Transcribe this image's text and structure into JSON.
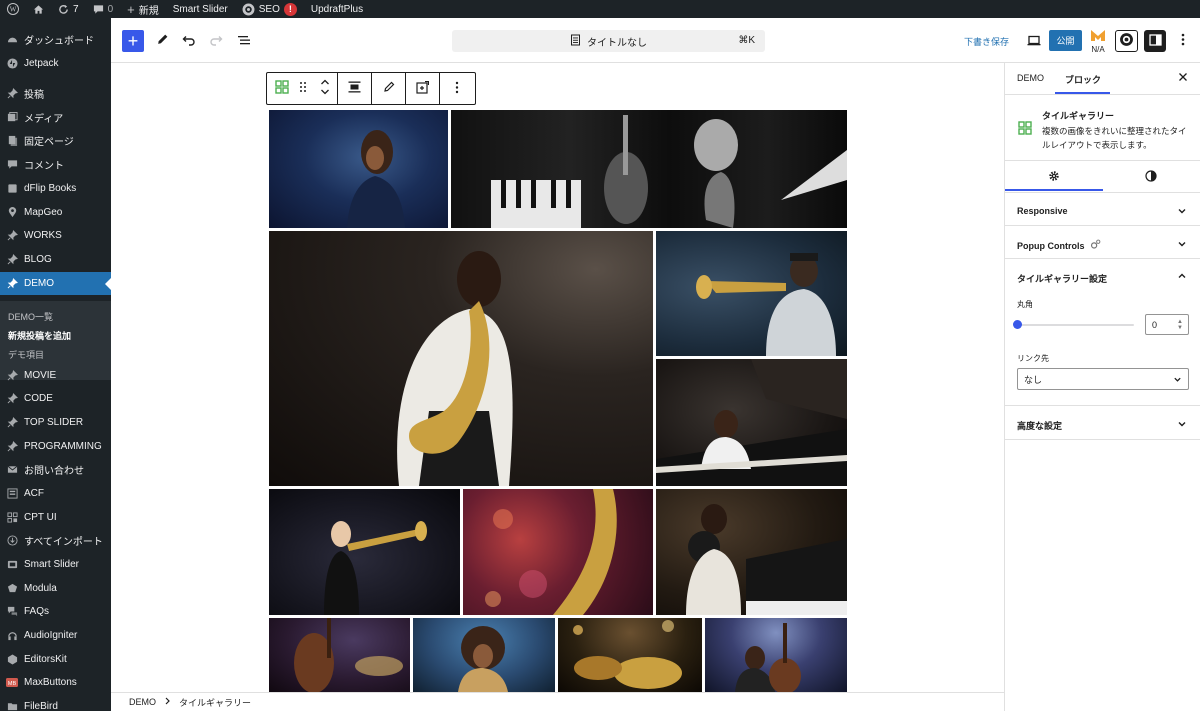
{
  "admin_bar": {
    "updates_count": "7",
    "comments_count": "0",
    "new_label": "新規",
    "smart_slider": "Smart Slider",
    "seo_label": "SEO",
    "seo_badge": "!",
    "updraft": "UpdraftPlus"
  },
  "sidebar": {
    "items": [
      {
        "label": "ダッシュボード",
        "icon": "dashboard-icon"
      },
      {
        "label": "Jetpack",
        "icon": "jetpack-icon"
      },
      {
        "label": "投稿",
        "icon": "pin-icon"
      },
      {
        "label": "メディア",
        "icon": "media-icon"
      },
      {
        "label": "固定ページ",
        "icon": "page-icon"
      },
      {
        "label": "コメント",
        "icon": "comment-icon"
      },
      {
        "label": "dFlip Books",
        "icon": "book-icon"
      },
      {
        "label": "MapGeo",
        "icon": "map-icon"
      },
      {
        "label": "WORKS",
        "icon": "pin-icon"
      },
      {
        "label": "BLOG",
        "icon": "pin-icon"
      },
      {
        "label": "DEMO",
        "icon": "pin-icon"
      },
      {
        "label": "MOVIE",
        "icon": "pin-icon"
      },
      {
        "label": "CODE",
        "icon": "pin-icon"
      },
      {
        "label": "TOP SLIDER",
        "icon": "pin-icon"
      },
      {
        "label": "PROGRAMMING",
        "icon": "pin-icon"
      },
      {
        "label": "お問い合わせ",
        "icon": "mail-icon"
      },
      {
        "label": "ACF",
        "icon": "acf-icon"
      },
      {
        "label": "CPT UI",
        "icon": "cpt-icon"
      },
      {
        "label": "すべてインポート",
        "icon": "import-icon"
      },
      {
        "label": "Smart Slider",
        "icon": "slider-icon"
      },
      {
        "label": "Modula",
        "icon": "modula-icon"
      },
      {
        "label": "FAQs",
        "icon": "faq-icon"
      },
      {
        "label": "AudioIgniter",
        "icon": "audio-icon"
      },
      {
        "label": "EditorsKit",
        "icon": "editorskit-icon"
      },
      {
        "label": "MaxButtons",
        "icon": "maxbuttons-icon"
      },
      {
        "label": "FileBird",
        "icon": "folder-icon"
      }
    ],
    "submenu": [
      "DEMO一覧",
      "新規投稿を追加",
      "デモ項目"
    ]
  },
  "header": {
    "doc_title": "タイトルなし",
    "shortcut": "⌘K",
    "save_draft": "下書き保存",
    "publish": "公開",
    "na": "N/A"
  },
  "settings": {
    "tab_post": "DEMO",
    "tab_block": "ブロック",
    "block_name": "タイルギャラリー",
    "block_desc": "複数の画像をきれいに整理されたタイルレイアウトで表示します。",
    "panels": {
      "responsive": "Responsive",
      "popup": "Popup Controls",
      "tile_settings": "タイルギャラリー設定",
      "advanced": "高度な設定"
    },
    "radius_label": "丸角",
    "radius_value": "0",
    "radius_level": 0,
    "link_label": "リンク先",
    "link_value": "なし"
  },
  "breadcrumb": {
    "root": "DEMO",
    "current": "タイルギャラリー"
  },
  "colors": {
    "accent": "#3858e9",
    "wp_blue": "#2271b1",
    "admin_dark": "#1d2327"
  }
}
